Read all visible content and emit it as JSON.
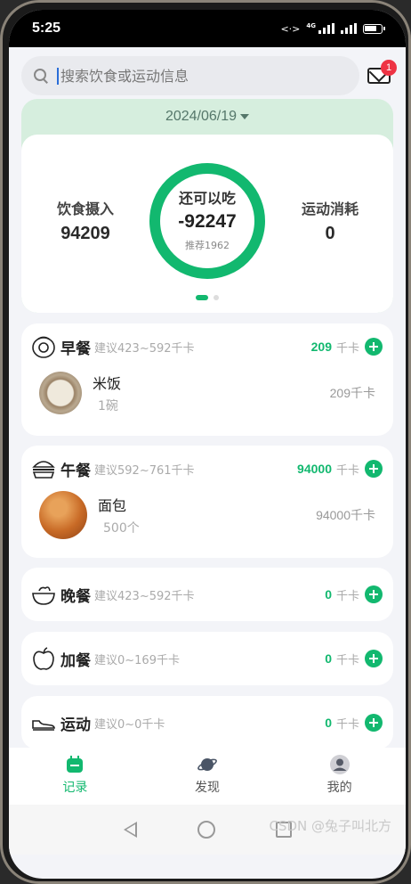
{
  "status_bar": {
    "time": "5:25",
    "network": "4G"
  },
  "search": {
    "placeholder": "搜索饮食或运动信息",
    "mail_badge": "1"
  },
  "summary": {
    "date": "2024/06/19",
    "intake_label": "饮食摄入",
    "intake_value": "94209",
    "remaining_label": "还可以吃",
    "remaining_value": "-92247",
    "recommended": "推荐1962",
    "burn_label": "运动消耗",
    "burn_value": "0"
  },
  "meals": [
    {
      "name": "早餐",
      "hint": "建议423~592千卡",
      "kcal": "209",
      "unit": "千卡",
      "icon": "egg-icon",
      "food": {
        "name": "米饭",
        "amount": "1碗",
        "kcal": "209千卡"
      }
    },
    {
      "name": "午餐",
      "hint": "建议592~761千卡",
      "kcal": "94000",
      "unit": "千卡",
      "icon": "burger-icon",
      "food": {
        "name": "面包",
        "amount": "500个",
        "kcal": "94000千卡"
      }
    },
    {
      "name": "晚餐",
      "hint": "建议423~592千卡",
      "kcal": "0",
      "unit": "千卡",
      "icon": "bowl-icon"
    },
    {
      "name": "加餐",
      "hint": "建议0~169千卡",
      "kcal": "0",
      "unit": "千卡",
      "icon": "apple-icon"
    },
    {
      "name": "运动",
      "hint": "建议0~0千卡",
      "kcal": "0",
      "unit": "千卡",
      "icon": "sneaker-icon"
    }
  ],
  "tabs": [
    {
      "label": "记录",
      "icon": "calendar-icon",
      "active": true
    },
    {
      "label": "发现",
      "icon": "planet-icon",
      "active": false
    },
    {
      "label": "我的",
      "icon": "user-icon",
      "active": false
    }
  ],
  "watermark": "CSDN @兔子叫北方",
  "colors": {
    "accent": "#12b86f",
    "header_bg": "#d6eede",
    "badge": "#ee3344"
  }
}
